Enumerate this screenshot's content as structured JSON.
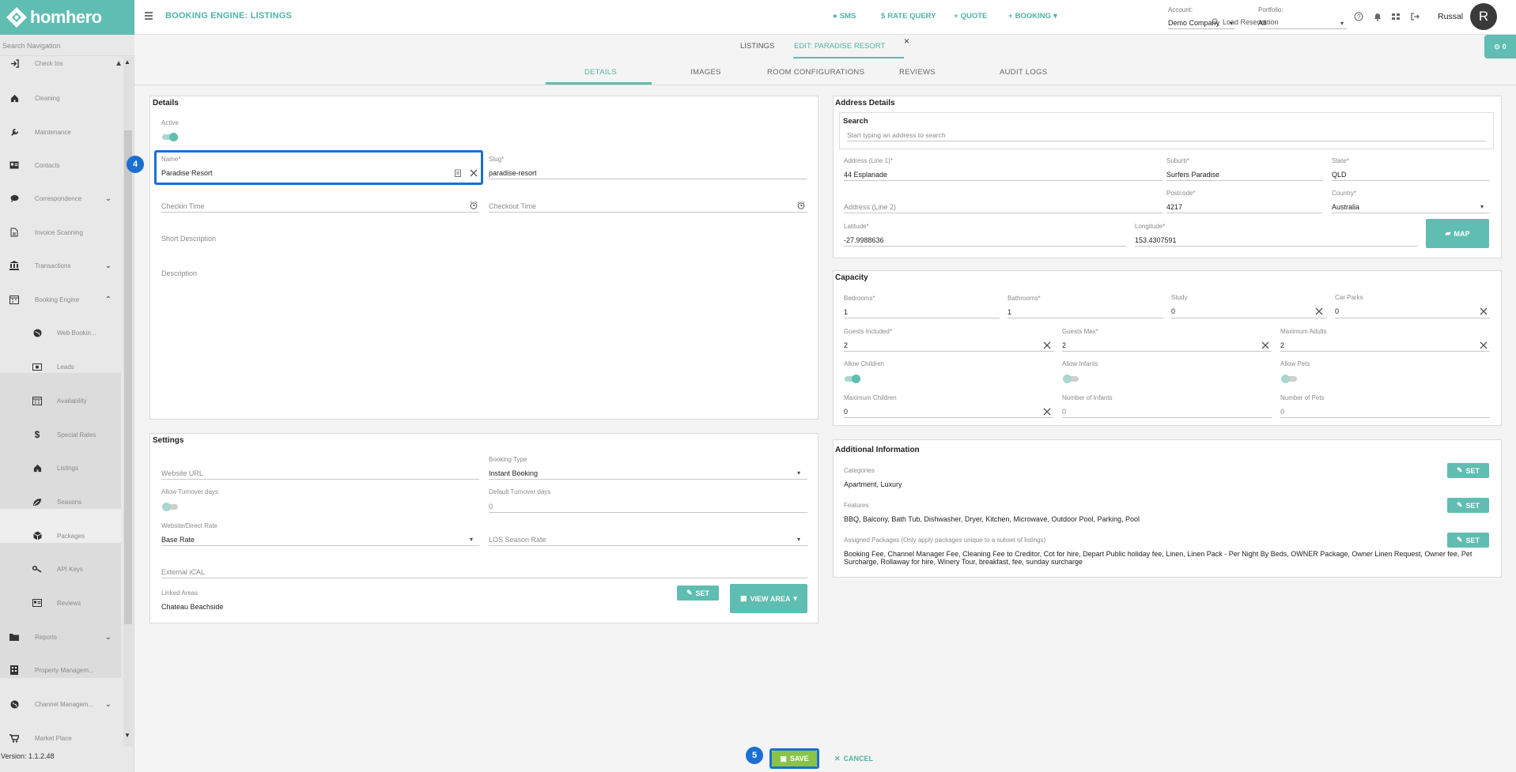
{
  "app": {
    "name": "homhero",
    "version": "Version: 1.1.2.48"
  },
  "sidebar": {
    "search_placeholder": "Search Navigation",
    "items": [
      {
        "label": "Check Ins",
        "icon": "sign-in-icon"
      },
      {
        "label": "Cleaning",
        "icon": "home-icon"
      },
      {
        "label": "Maintenance",
        "icon": "wrench-icon"
      },
      {
        "label": "Contacts",
        "icon": "address-card-icon"
      },
      {
        "label": "Correspondence",
        "icon": "chat-bubble-icon"
      },
      {
        "label": "Invoice Scanning",
        "icon": "document-icon"
      },
      {
        "label": "Transactions",
        "icon": "bank-icon"
      },
      {
        "label": "Booking Engine",
        "icon": "calendar-icon"
      },
      {
        "label": "Web Bookin...",
        "icon": "globe-icon"
      },
      {
        "label": "Leads",
        "icon": "money-icon"
      },
      {
        "label": "Availability",
        "icon": "calendar-icon"
      },
      {
        "label": "Special Rates",
        "icon": "dollar-icon"
      },
      {
        "label": "Listings",
        "icon": "home-icon"
      },
      {
        "label": "Seasons",
        "icon": "leaf-icon"
      },
      {
        "label": "Packages",
        "icon": "box-icon"
      },
      {
        "label": "API Keys",
        "icon": "key-icon"
      },
      {
        "label": "Reviews",
        "icon": "id-card-icon"
      },
      {
        "label": "Reports",
        "icon": "folder-icon"
      },
      {
        "label": "Property Managem...",
        "icon": "building-icon"
      },
      {
        "label": "Channel Managem...",
        "icon": "globe-icon"
      },
      {
        "label": "Market Place",
        "icon": "cart-icon"
      }
    ]
  },
  "header": {
    "title": "BOOKING ENGINE: LISTINGS",
    "actions": {
      "sms": "SMS",
      "rate_query": "RATE QUERY",
      "quote": "QUOTE",
      "booking": "BOOKING"
    },
    "load_reservation": "Load Reservation",
    "account_label": "Account:",
    "account_value": "Demo Company",
    "portfolio_label": "Portfolio:",
    "portfolio_value": "All",
    "user_name": "Russal",
    "avatar_initial": "R"
  },
  "tabs_top": {
    "listings": "LISTINGS",
    "edit": "EDIT: PARADISE RESORT",
    "notifications": "0"
  },
  "tabs_sub": {
    "details": "DETAILS",
    "images": "IMAGES",
    "rooms": "ROOM CONFIGURATIONS",
    "reviews": "REVIEWS",
    "audit": "AUDIT LOGS"
  },
  "details": {
    "title": "Details",
    "active_label": "Active",
    "active": true,
    "name_label": "Name*",
    "name_value": "Paradise Resort",
    "slug_label": "Slug*",
    "slug_value": "paradise-resort",
    "checkin_placeholder": "Checkin Time",
    "checkout_placeholder": "Checkout Time",
    "short_desc_placeholder": "Short Description",
    "desc_placeholder": "Description"
  },
  "settings": {
    "title": "Settings",
    "website_url_placeholder": "Website URL",
    "booking_type_label": "Booking Type",
    "booking_type_value": "Instant Booking",
    "allow_turnover_label": "Allow Turnover days",
    "allow_turnover": false,
    "default_turnover_label": "Default Turnover days",
    "default_turnover_value": "0",
    "direct_rate_label": "Website/Direct Rate",
    "direct_rate_value": "Base Rate",
    "los_placeholder": "LOS Season Rate",
    "ical_placeholder": "External iCAL",
    "linked_areas_label": "Linked Areas",
    "linked_areas_value": "Chateau Beachside",
    "set_button": "SET",
    "view_area_button": "VIEW AREA"
  },
  "address": {
    "title": "Address Details",
    "search_label": "Search",
    "search_placeholder": "Start typing an address to search",
    "line1_label": "Address (Line 1)*",
    "line1_value": "44 Esplanade",
    "suburb_label": "Suburb*",
    "suburb_value": "Surfers Paradise",
    "state_label": "State*",
    "state_value": "QLD",
    "line2_placeholder": "Address (Line 2)",
    "postcode_label": "Postcode*",
    "postcode_value": "4217",
    "country_label": "Country*",
    "country_value": "Australia",
    "lat_label": "Latitude*",
    "lat_value": "-27.9988636",
    "lng_label": "Longitude*",
    "lng_value": "153.4307591",
    "map_button": "MAP"
  },
  "capacity": {
    "title": "Capacity",
    "bedrooms_label": "Bedrooms*",
    "bedrooms_value": "1",
    "bathrooms_label": "Bathrooms*",
    "bathrooms_value": "1",
    "study_label": "Study",
    "study_value": "0",
    "carparks_label": "Car Parks",
    "carparks_value": "0",
    "guests_incl_label": "Guests Included*",
    "guests_incl_value": "2",
    "guests_max_label": "Guests Max*",
    "guests_max_value": "2",
    "max_adults_label": "Maximum Adults",
    "max_adults_value": "2",
    "allow_children_label": "Allow Children",
    "allow_children": true,
    "allow_infants_label": "Allow Infants",
    "allow_infants": false,
    "allow_pets_label": "Allow Pets",
    "allow_pets": false,
    "max_children_label": "Maximum Children",
    "max_children_value": "0",
    "num_infants_label": "Number of Infants",
    "num_infants_value": "0",
    "num_pets_label": "Number of Pets",
    "num_pets_value": "0"
  },
  "additional": {
    "title": "Additional Information",
    "categories_label": "Categories",
    "categories_value": "Apartment, Luxury",
    "features_label": "Features",
    "features_value": "BBQ, Balcony, Bath Tub, Dishwasher, Dryer, Kitchen, Microwave, Outdoor Pool, Parking, Pool",
    "packages_label": "Assigned Packages (Only apply packages unique to a subset of listings)",
    "packages_line1": "Booking Fee, Channel Manager Fee, Cleaning Fee to Creditor, Cot for hire, Depart Public holiday fee, Linen, Linen Pack - Per Night By Beds, OWNER Package, Owner Linen Request, Owner fee, Pet",
    "packages_line2": "Surcharge, Rollaway for hire, Winery Tour, breakfast, fee, sunday surcharge",
    "set_button": "SET"
  },
  "footer": {
    "save": "SAVE",
    "cancel": "CANCEL"
  },
  "annotations": {
    "step4": "4",
    "step5": "5"
  },
  "colors": {
    "accent": "#5fbdb1",
    "highlight": "#1b6fd1",
    "save_bg": "#8bc34a"
  }
}
